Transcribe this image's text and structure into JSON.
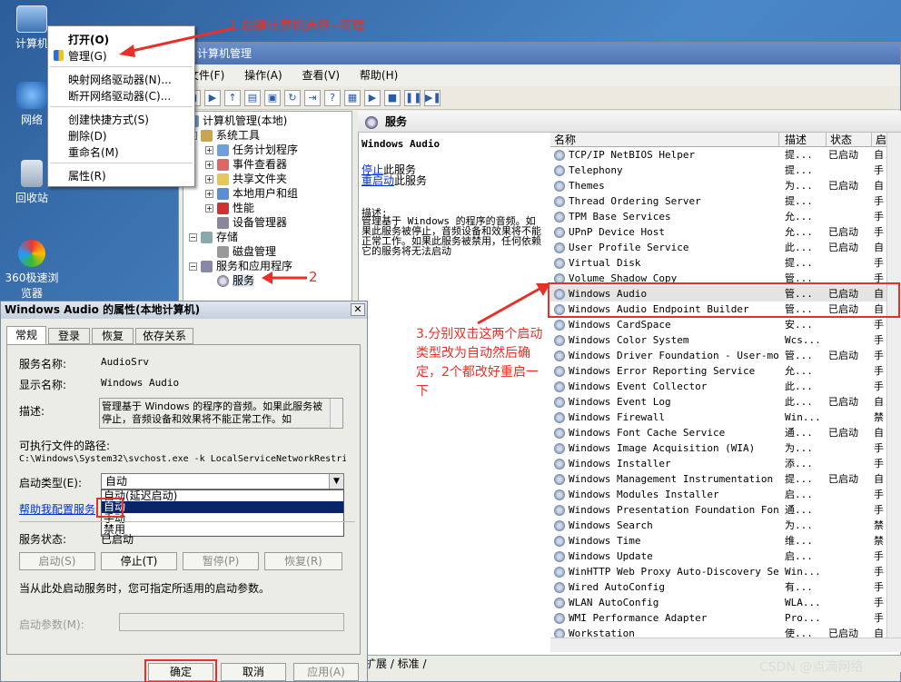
{
  "desktop": {
    "icons": [
      "计算机",
      "网络",
      "回收站",
      "360极速浏览器"
    ]
  },
  "context_menu": {
    "items": [
      "打开(O)",
      "管理(G)",
      "映射网络驱动器(N)...",
      "断开网络驱动器(C)...",
      "创建快捷方式(S)",
      "删除(D)",
      "重命名(M)",
      "属性(R)"
    ]
  },
  "main_window": {
    "title": "计算机管理",
    "menu": [
      "文件(F)",
      "操作(A)",
      "查看(V)",
      "帮助(H)"
    ]
  },
  "tree": {
    "root": "计算机管理(本地)",
    "items": [
      "系统工具",
      "任务计划程序",
      "事件查看器",
      "共享文件夹",
      "本地用户和组",
      "性能",
      "设备管理器",
      "存储",
      "磁盘管理",
      "服务和应用程序",
      "服务"
    ]
  },
  "services": {
    "header": "服务",
    "selected_name": "Windows Audio",
    "stop_link": "停止",
    "stop_suffix": "此服务",
    "restart_link": "重启动",
    "restart_suffix": "此服务",
    "desc_label": "描述:",
    "desc_text": "管理基于 Windows 的程序的音频。如果此服务被停止，音频设备和效果将不能正常工作。如果此服务被禁用，任何依赖它的服务将无法启动",
    "columns": [
      "名称",
      "描述",
      "状态",
      "启"
    ],
    "rows": [
      [
        "TCP/IP NetBIOS Helper",
        "提...",
        "已启动",
        "自"
      ],
      [
        "Telephony",
        "提...",
        "",
        "手"
      ],
      [
        "Themes",
        "为...",
        "已启动",
        "自"
      ],
      [
        "Thread Ordering Server",
        "提...",
        "",
        "手"
      ],
      [
        "TPM Base Services",
        "允...",
        "",
        "手"
      ],
      [
        "UPnP Device Host",
        "允...",
        "已启动",
        "手"
      ],
      [
        "User Profile Service",
        "此...",
        "已启动",
        "自"
      ],
      [
        "Virtual Disk",
        "提...",
        "",
        "手"
      ],
      [
        "Volume Shadow Copy",
        "管...",
        "",
        "手"
      ],
      [
        "Windows Audio",
        "管...",
        "已启动",
        "自"
      ],
      [
        "Windows Audio Endpoint Builder",
        "管...",
        "已启动",
        "自"
      ],
      [
        "Windows CardSpace",
        "安...",
        "",
        "手"
      ],
      [
        "Windows Color System",
        "Wcs...",
        "",
        "手"
      ],
      [
        "Windows Driver Foundation - User-mo...",
        "管...",
        "已启动",
        "手"
      ],
      [
        "Windows Error Reporting Service",
        "允...",
        "",
        "手"
      ],
      [
        "Windows Event Collector",
        "此...",
        "",
        "手"
      ],
      [
        "Windows Event Log",
        "此...",
        "已启动",
        "自"
      ],
      [
        "Windows Firewall",
        "Win...",
        "",
        "禁"
      ],
      [
        "Windows Font Cache Service",
        "通...",
        "已启动",
        "自"
      ],
      [
        "Windows Image Acquisition (WIA)",
        "为...",
        "",
        "手"
      ],
      [
        "Windows Installer",
        "添...",
        "",
        "手"
      ],
      [
        "Windows Management Instrumentation",
        "提...",
        "已启动",
        "自"
      ],
      [
        "Windows Modules Installer",
        "启...",
        "",
        "手"
      ],
      [
        "Windows Presentation Foundation Fon...",
        "通...",
        "",
        "手"
      ],
      [
        "Windows Search",
        "为...",
        "",
        "禁"
      ],
      [
        "Windows Time",
        "维...",
        "",
        "禁"
      ],
      [
        "Windows Update",
        "启...",
        "",
        "手"
      ],
      [
        "WinHTTP Web Proxy Auto-Discovery Se...",
        "Win...",
        "",
        "手"
      ],
      [
        "Wired AutoConfig",
        "有...",
        "",
        "手"
      ],
      [
        "WLAN AutoConfig",
        "WLA...",
        "",
        "手"
      ],
      [
        "WMI Performance Adapter",
        "Pro...",
        "",
        "手"
      ],
      [
        "Workstation",
        "使...",
        "已启动",
        "自"
      ]
    ],
    "bottom_tabs": "扩展 / 标准 /"
  },
  "dialog": {
    "title": "Windows Audio 的属性(本地计算机)",
    "tabs": [
      "常规",
      "登录",
      "恢复",
      "依存关系"
    ],
    "service_name_label": "服务名称:",
    "service_name": "AudioSrv",
    "display_name_label": "显示名称:",
    "display_name": "Windows Audio",
    "desc_label": "描述:",
    "desc_text": "管理基于 Windows 的程序的音频。如果此服务被停止，音频设备和效果将不能正常工作。如",
    "path_label": "可执行文件的路径:",
    "path": "C:\\Windows\\System32\\svchost.exe -k LocalServiceNetworkRestri",
    "startup_label": "启动类型(E):",
    "startup_value": "自动",
    "startup_options": [
      "自动(延迟启动)",
      "自动",
      "手动",
      "禁用"
    ],
    "help_link": "帮助我配置服务",
    "status_label": "服务状态:",
    "status_value": "已启动",
    "btn_start": "启动(S)",
    "btn_stop": "停止(T)",
    "btn_pause": "暂停(P)",
    "btn_resume": "恢复(R)",
    "hint": "当从此处启动服务时，您可指定所适用的启动参数。",
    "param_label": "启动参数(M):",
    "btn_ok": "确定",
    "btn_cancel": "取消",
    "btn_apply": "应用(A)"
  },
  "annotations": {
    "step1": "1.右键计算机选择--管理",
    "step2": "2",
    "step3": "3.分别双击这两个启动类型改为自动然后确定，2个都改好重启一下",
    "watermark": "CSDN @点滴网络"
  }
}
